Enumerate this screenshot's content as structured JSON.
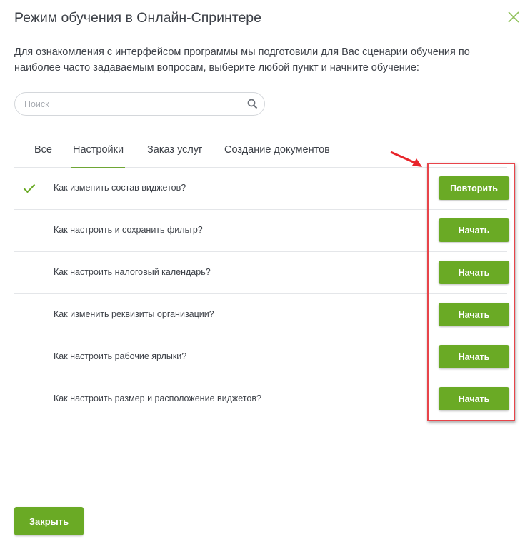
{
  "dialog": {
    "title": "Режим обучения в Онлайн-Спринтере",
    "intro": "Для ознакомления с интерфейсом программы мы подготовили для Вас сценарии обучения по наиболее часто задаваемым вопросам, выберите любой пункт и начните обучение:",
    "close_icon": "close-x-icon"
  },
  "search": {
    "placeholder": "Поиск",
    "value": "",
    "icon": "search-icon"
  },
  "tabs": [
    {
      "label": "Все",
      "active": false
    },
    {
      "label": "Настройки",
      "active": true
    },
    {
      "label": "Заказ услуг",
      "active": false
    },
    {
      "label": "Создание документов",
      "active": false
    }
  ],
  "scenarios": [
    {
      "question": "Как изменить состав виджетов?",
      "button": "Повторить",
      "completed": true
    },
    {
      "question": "Как настроить и сохранить фильтр?",
      "button": "Начать",
      "completed": false
    },
    {
      "question": "Как настроить налоговый календарь?",
      "button": "Начать",
      "completed": false
    },
    {
      "question": "Как изменить реквизиты организации?",
      "button": "Начать",
      "completed": false
    },
    {
      "question": "Как настроить рабочие ярлыки?",
      "button": "Начать",
      "completed": false
    },
    {
      "question": "Как настроить размер и расположение виджетов?",
      "button": "Начать",
      "completed": false
    }
  ],
  "footer": {
    "close_label": "Закрыть"
  },
  "colors": {
    "accent_green": "#6aaa25",
    "tab_underline": "#6ea635",
    "annotation_red": "#e8444a"
  }
}
